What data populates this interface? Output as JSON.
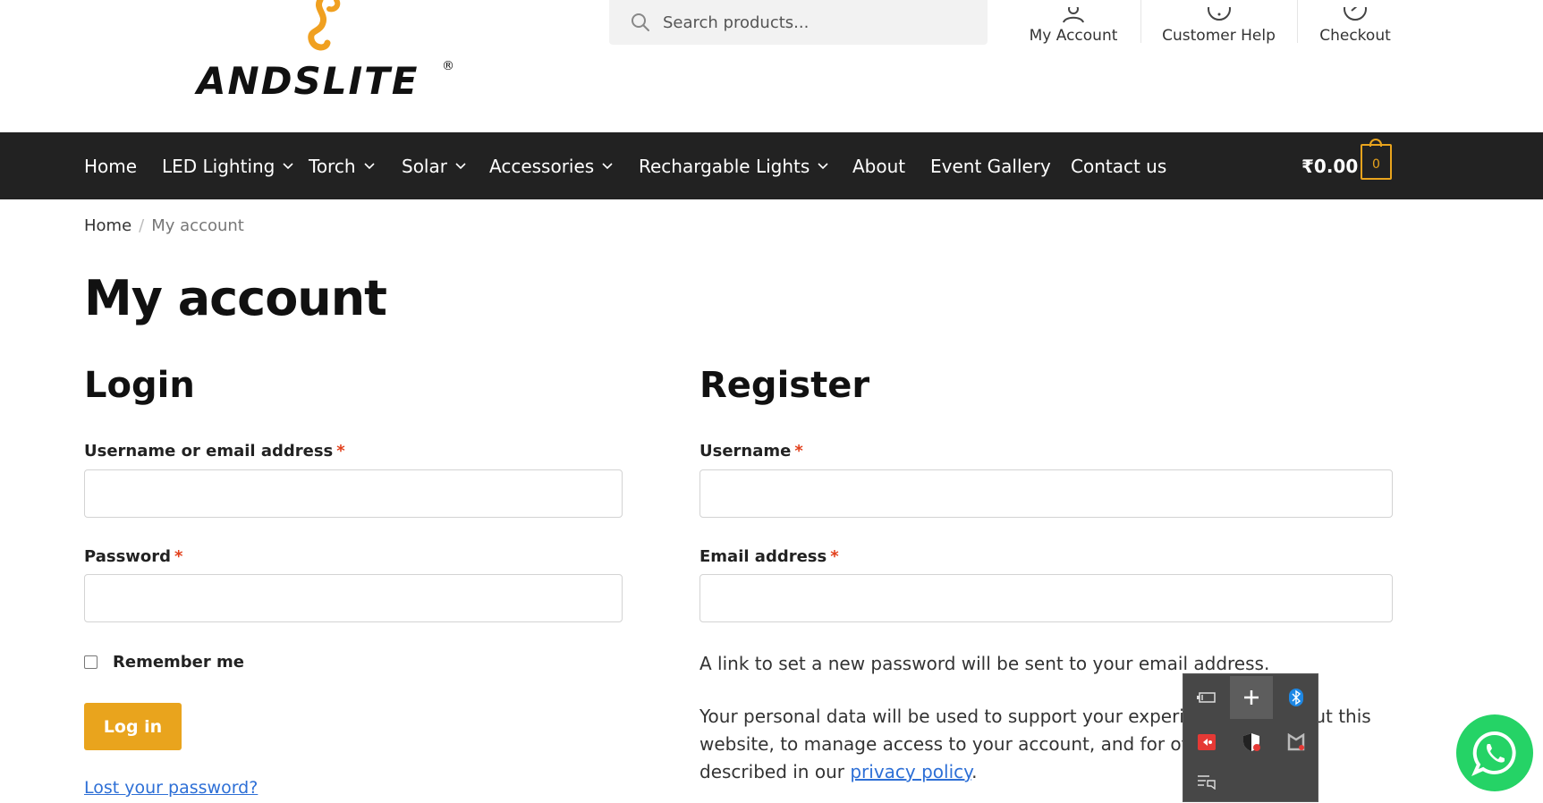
{
  "brand": {
    "name": "ANDSLITE",
    "reg_mark": "®"
  },
  "search": {
    "placeholder": "Search products..."
  },
  "header_links": [
    {
      "label": "My Account",
      "icon": "user-icon"
    },
    {
      "label": "Customer Help",
      "icon": "help-icon"
    },
    {
      "label": "Checkout",
      "icon": "checkout-icon"
    }
  ],
  "nav": {
    "items": [
      {
        "label": "Home",
        "has_dropdown": false
      },
      {
        "label": "LED Lighting",
        "has_dropdown": true
      },
      {
        "label": "Torch",
        "has_dropdown": true
      },
      {
        "label": "Solar",
        "has_dropdown": true
      },
      {
        "label": "Accessories",
        "has_dropdown": true
      },
      {
        "label": "Rechargable Lights",
        "has_dropdown": true
      },
      {
        "label": "About",
        "has_dropdown": false
      },
      {
        "label": "Event Gallery",
        "has_dropdown": false
      },
      {
        "label": "Contact us",
        "has_dropdown": false
      }
    ],
    "cart_total": "₹0.00",
    "cart_count": "0"
  },
  "breadcrumb": {
    "home": "Home",
    "separator": "/",
    "current": "My account"
  },
  "page_title": "My account",
  "login": {
    "title": "Login",
    "username_label": "Username or email address",
    "password_label": "Password",
    "required_mark": "*",
    "remember_label": "Remember me",
    "button_label": "Log in",
    "lost_password_link": "Lost your password?"
  },
  "register": {
    "title": "Register",
    "username_label": "Username",
    "email_label": "Email address",
    "required_mark": "*",
    "password_note": "A link to set a new password will be sent to your email address.",
    "privacy_prefix": "Your personal data will be used to support your experience throughout this website, to manage access to your account, and for other purposes described in our ",
    "privacy_link": "privacy policy",
    "privacy_suffix": "."
  },
  "tray_icons": [
    "battery-icon",
    "add-icon",
    "bluetooth-icon",
    "screen-record-icon",
    "security-shield-icon",
    "mcafee-icon",
    "action-center-icon"
  ],
  "colors": {
    "accent": "#e9a41d",
    "nav_bg": "#222222",
    "link": "#2d6fd6",
    "required": "#e2401c",
    "whatsapp": "#25d366"
  }
}
